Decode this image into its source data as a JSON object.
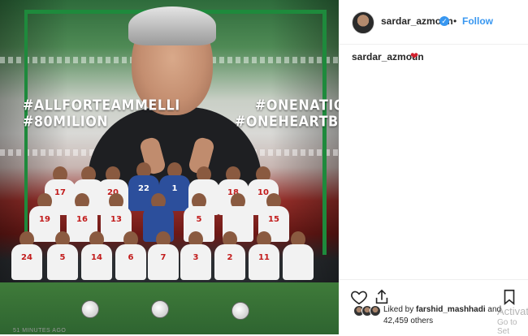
{
  "post": {
    "image_hashtags": {
      "left_line1": "#ALLFORTEAMMELLI",
      "left_line2": "#80MILION",
      "right_line1": "#ONENATION",
      "right_line2": "#ONEHEARTBEAT"
    },
    "jersey_numbers": {
      "back_row": [
        "17",
        "22",
        "1",
        "18",
        "10"
      ],
      "back_row_left": [
        "19",
        "17",
        "20"
      ],
      "middle_row": [
        "16",
        "13",
        "5",
        "15"
      ],
      "front_row": [
        "24",
        "5",
        "14",
        "6",
        "7",
        "3",
        "2",
        "11"
      ]
    }
  },
  "header": {
    "username": "sardar_azmoun",
    "verified_icon": "verified-badge-icon",
    "separator": "•",
    "follow_label": "Follow"
  },
  "caption": {
    "username": "sardar_azmoun",
    "emoji": "❤"
  },
  "actions": {
    "like_icon": "heart-outline-icon",
    "share_icon": "share-icon",
    "save_icon": "bookmark-icon"
  },
  "likes": {
    "liked_by_prefix": "Liked by",
    "liked_by_user": "farshid_mashhadi",
    "liked_by_suffix": "and",
    "count": "42,459 others"
  },
  "timestamp": "51 MINUTES AGO",
  "os_watermark": {
    "line1": "Activat",
    "line2": "Go to Set"
  },
  "colors": {
    "link_blue": "#3897f0",
    "text_dark": "#262626",
    "frame_green": "#1e8a3c",
    "heart_red": "#d21f2d"
  }
}
